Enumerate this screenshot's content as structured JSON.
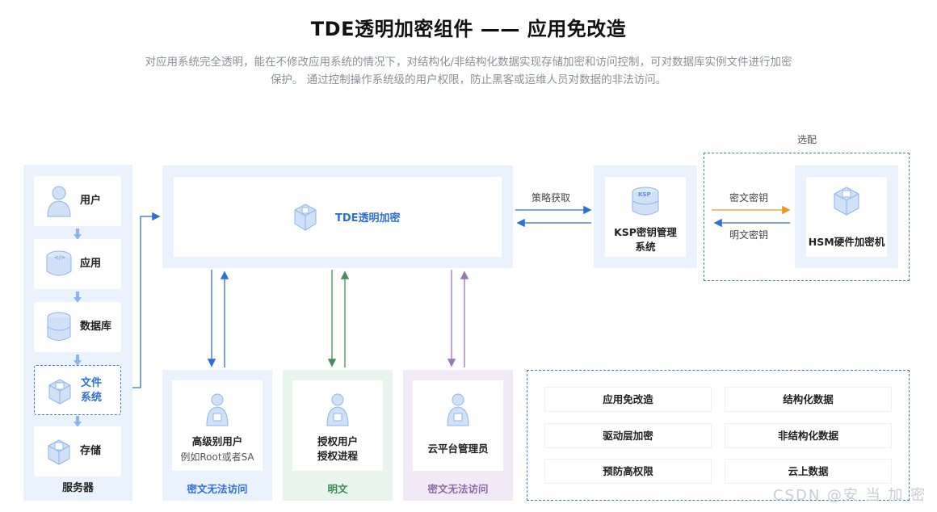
{
  "header": {
    "title": "TDE透明加密组件 —— 应用免改造",
    "subtitle_line1": "对应用系统完全透明，能在不修改应用系统的情况下，对结构化/非结构化数据实现存储加密和访问控制，可对数据库实例文件进行加密",
    "subtitle_line2": "保护。 通过控制操作系统级的用户权限，防止黑客或运维人员对数据的非法访问。"
  },
  "server": {
    "items": [
      {
        "label": "用户",
        "icon": "user-icon"
      },
      {
        "label": "应用",
        "icon": "application-icon"
      },
      {
        "label": "数据库",
        "icon": "database-icon"
      },
      {
        "label": "文件系统",
        "label_l1": "文件",
        "label_l2": "系统",
        "icon": "file-system-icon"
      },
      {
        "label": "存储",
        "icon": "storage-icon"
      }
    ],
    "footer": "服务器"
  },
  "tde": {
    "label": "TDE透明加密",
    "icon": "tde-encryption-icon"
  },
  "policy_label": "策略获取",
  "ksp": {
    "label_l1": "KSP密钥管理",
    "label_l2": "系统",
    "icon": "ksp-key-icon"
  },
  "optional": {
    "label": "选配",
    "cipher_key": "密文密钥",
    "plain_key": "明文密钥"
  },
  "hsm": {
    "label": "HSM硬件加密机",
    "icon": "hsm-device-icon"
  },
  "users": [
    {
      "title": "高级别用户",
      "sub": "例如Root或者SA",
      "footer": "密文无法访问",
      "footer_color": "#2f6fd8",
      "bg": "#eaf2fd",
      "arrow_color": "#2f6fd8"
    },
    {
      "title": "授权用户",
      "title_l2": "授权进程",
      "footer": "明文",
      "footer_color": "#3e8a53",
      "bg": "#e8f5ec",
      "arrow_color": "#4a8a5e"
    },
    {
      "title": "云平台管理员",
      "footer": "密文无法访问",
      "footer_color": "#8e6aa6",
      "bg": "#f1eaf6",
      "arrow_color": "#9a78ad"
    }
  ],
  "features": [
    [
      "应用免改造",
      "结构化数据"
    ],
    [
      "驱动层加密",
      "非结构化数据"
    ],
    [
      "预防高权限",
      "云上数据"
    ]
  ],
  "watermark": "CSDN @安 当 加 密",
  "colors": {
    "primary_blue": "#2f6fd8",
    "light_panel": "#eaf2fd",
    "orange_arrow": "#f0931f",
    "green": "#3e8a53",
    "purple": "#8e6aa6"
  }
}
